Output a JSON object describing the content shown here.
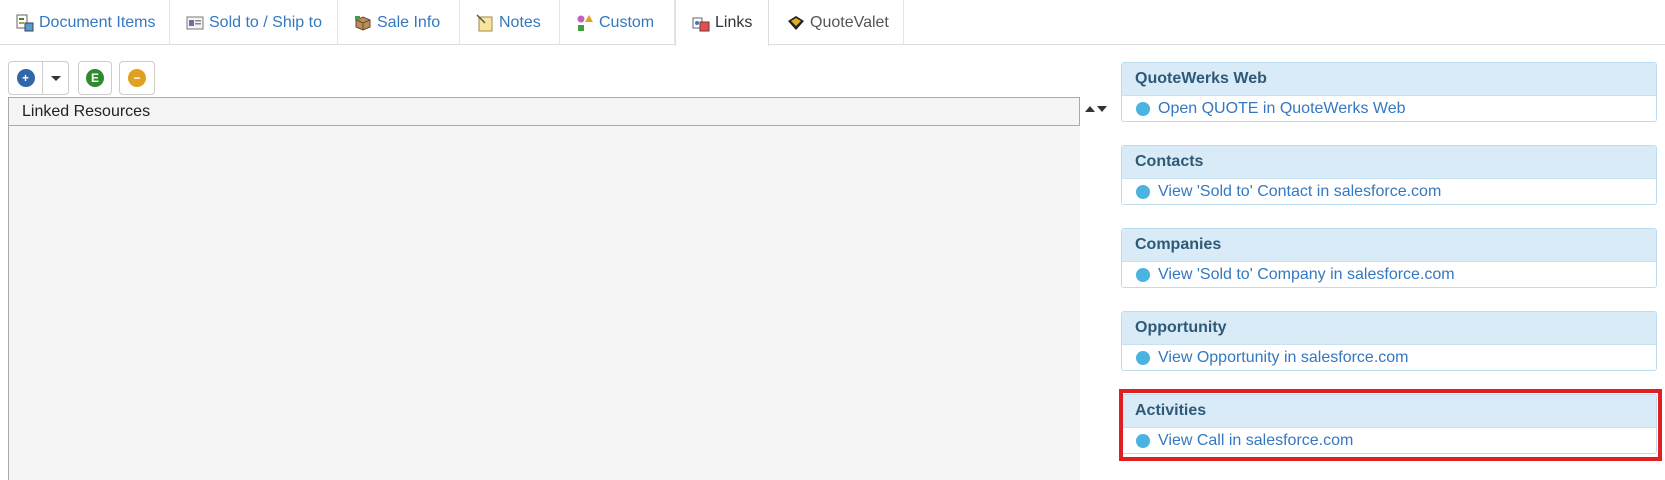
{
  "tabs": [
    {
      "label": "Document Items",
      "icon": "document-items-icon"
    },
    {
      "label": "Sold to / Ship to",
      "icon": "address-card-icon"
    },
    {
      "label": "Sale Info",
      "icon": "box-icon"
    },
    {
      "label": "Notes",
      "icon": "note-icon"
    },
    {
      "label": "Custom",
      "icon": "shapes-icon"
    },
    {
      "label": "Links",
      "icon": "links-icon",
      "active": true
    },
    {
      "label": "QuoteValet",
      "icon": "quotevalet-icon"
    }
  ],
  "toolbar": {
    "add_symbol": "+",
    "add_color": "#2f67a8",
    "e_symbol": "E",
    "e_color": "#2e8a2e",
    "remove_symbol": "−",
    "remove_color": "#e0a020"
  },
  "linked_resources": {
    "header": "Linked Resources"
  },
  "panels": [
    {
      "title": "QuoteWerks Web",
      "link": "Open QUOTE in QuoteWerks Web"
    },
    {
      "title": "Contacts",
      "link": "View 'Sold to' Contact in salesforce.com"
    },
    {
      "title": "Companies",
      "link": "View 'Sold to' Company in salesforce.com"
    },
    {
      "title": "Opportunity",
      "link": "View Opportunity in salesforce.com"
    },
    {
      "title": "Activities",
      "link": "View Call in salesforce.com",
      "highlighted": true
    }
  ],
  "colors": {
    "link": "#3478c0",
    "panel_header_bg": "#d9ebf7",
    "panel_header_text": "#2e5a78",
    "bullet": "#4ab3e2",
    "highlight": "#e02020"
  }
}
